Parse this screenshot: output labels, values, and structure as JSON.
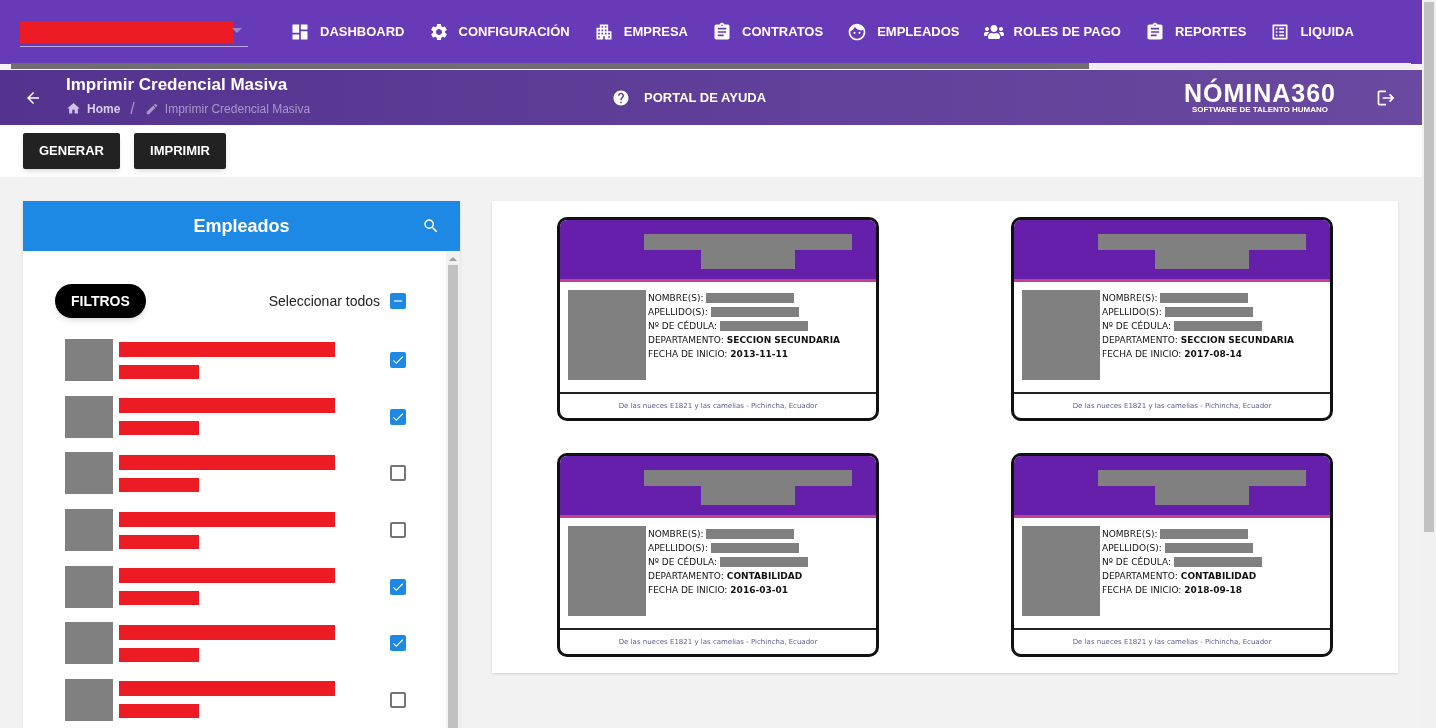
{
  "nav": {
    "items": [
      {
        "label": "DASHBOARD"
      },
      {
        "label": "CONFIGURACIÓN"
      },
      {
        "label": "EMPRESA"
      },
      {
        "label": "CONTRATOS"
      },
      {
        "label": "EMPLEADOS"
      },
      {
        "label": "ROLES DE PAGO"
      },
      {
        "label": "REPORTES"
      },
      {
        "label": "LIQUIDA"
      }
    ],
    "scroll_progress": {
      "level": 0.77
    }
  },
  "header": {
    "title": "Imprimir Credencial Masiva",
    "breadcrumb": [
      "Home",
      "/",
      "Imprimir Credencial Masiva"
    ],
    "help": "PORTAL DE AYUDA",
    "logo": {
      "name": "NÓMINA360",
      "tagline": "SOFTWARE DE TALENTO HUMANO"
    }
  },
  "toolbar": {
    "buttons": [
      "GENERAR",
      "IMPRIMIR"
    ]
  },
  "employees": {
    "title": "Empleados",
    "filter_button": "FILTROS",
    "select_all": {
      "label": "Seleccionar todos",
      "checked": true,
      "indeterminate": true
    },
    "rows": [
      {
        "checked": true
      },
      {
        "checked": true
      },
      {
        "checked": false
      },
      {
        "checked": false
      },
      {
        "checked": true
      },
      {
        "checked": true
      },
      {
        "checked": false
      }
    ]
  },
  "cards": [
    {
      "fields": [
        {
          "label": "NOMBRE(S):"
        },
        {
          "label": "APELLIDO(S):"
        },
        {
          "label": "Nº DE CÉDULA:"
        },
        {
          "label": "DEPARTAMENTO:",
          "value": "SECCION SECUNDARIA"
        },
        {
          "label": "FECHA DE INICIO:",
          "value": "2013-11-11"
        }
      ],
      "address": "De las nueces E1821 y las camelias - Pichincha, Ecuador"
    },
    {
      "fields": [
        {
          "label": "NOMBRE(S):"
        },
        {
          "label": "APELLIDO(S):"
        },
        {
          "label": "Nº DE CÉDULA:"
        },
        {
          "label": "DEPARTAMENTO:",
          "value": "SECCION SECUNDARIA"
        },
        {
          "label": "FECHA DE INICIO:",
          "value": "2017-08-14"
        }
      ],
      "address": "De las nueces E1821 y las camelias - Pichincha, Ecuador"
    },
    {
      "fields": [
        {
          "label": "NOMBRE(S):"
        },
        {
          "label": "APELLIDO(S):"
        },
        {
          "label": "Nº DE CÉDULA:"
        },
        {
          "label": "DEPARTAMENTO:",
          "value": "CONTABILIDAD"
        },
        {
          "label": "FECHA DE INICIO:",
          "value": "2016-03-01"
        }
      ],
      "address": "De las nueces E1821 y las camelias - Pichincha, Ecuador"
    },
    {
      "fields": [
        {
          "label": "NOMBRE(S):"
        },
        {
          "label": "APELLIDO(S):"
        },
        {
          "label": "Nº DE CÉDULA:"
        },
        {
          "label": "DEPARTAMENTO:",
          "value": "CONTABILIDAD"
        },
        {
          "label": "FECHA DE INICIO:",
          "value": "2018-09-18"
        }
      ],
      "address": "De las nueces E1821 y las camelias - Pichincha, Ecuador"
    }
  ]
}
